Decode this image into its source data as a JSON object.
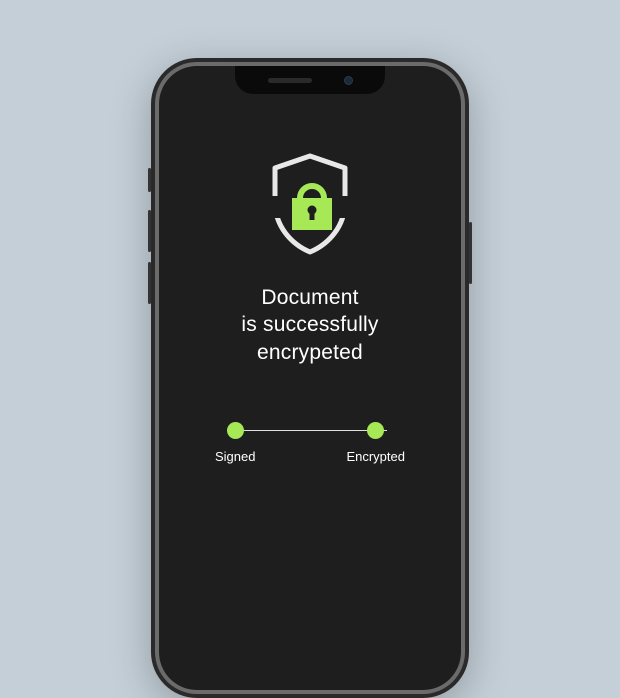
{
  "colors": {
    "accent": "#a7e856",
    "screen_bg": "#1e1e1e",
    "page_bg": "#c4cfd7"
  },
  "icon": {
    "name": "shield-lock-icon"
  },
  "headline": {
    "line1": "Document",
    "line2": "is successfully",
    "line3": "encrypeted"
  },
  "steps": [
    {
      "label": "Signed",
      "done": true
    },
    {
      "label": "Encrypted",
      "done": true
    }
  ]
}
